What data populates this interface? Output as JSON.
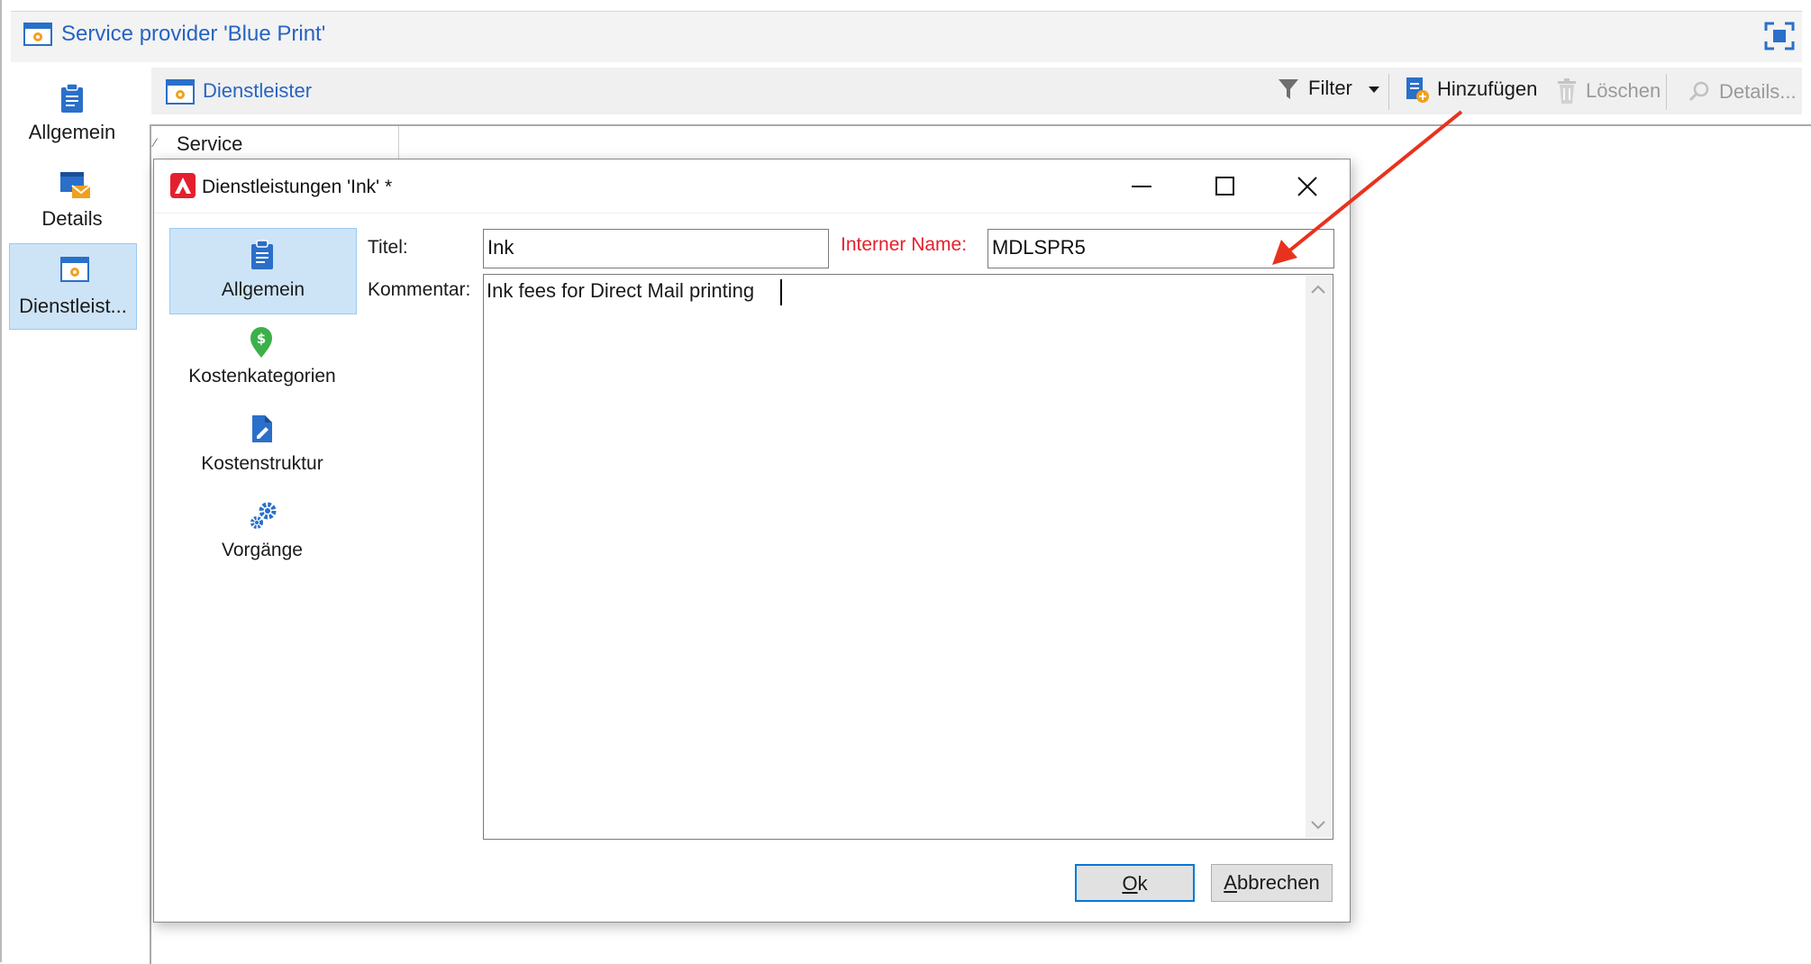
{
  "window": {
    "title": "Service provider 'Blue Print'",
    "title_icon": "provider-window-icon",
    "maximize_icon": "fullscreen-icon"
  },
  "left_nav": [
    {
      "label": "Allgemein",
      "icon": "clipboard-icon"
    },
    {
      "label": "Details",
      "icon": "details-mail-icon"
    },
    {
      "label": "Dienstleist...",
      "icon": "service-window-icon",
      "selected": true
    }
  ],
  "toolbar": {
    "section_label": "Dienstleister",
    "filter_label": "Filter",
    "add_label": "Hinzufügen",
    "delete_label": "Löschen",
    "details_label": "Details..."
  },
  "list": {
    "column_header": "Service"
  },
  "dialog": {
    "title": "Dienstleistungen 'Ink' *",
    "nav": [
      {
        "label": "Allgemein",
        "icon": "clipboard-icon",
        "selected": true
      },
      {
        "label": "Kostenkategorien",
        "icon": "dollar-pin-icon"
      },
      {
        "label": "Kostenstruktur",
        "icon": "edit-document-icon"
      },
      {
        "label": "Vorgänge",
        "icon": "gears-icon"
      }
    ],
    "fields": {
      "title_label": "Titel:",
      "title_value": "Ink",
      "internal_name_label": "Interner Name:",
      "internal_name_value": "MDLSPR5",
      "comment_label": "Kommentar:",
      "comment_value": "Ink fees for Direct Mail printing"
    },
    "buttons": {
      "ok_mnemonic": "O",
      "ok_rest": "k",
      "cancel_mnemonic": "A",
      "cancel_rest": "bbrechen"
    }
  },
  "colors": {
    "accent": "#2764c3",
    "selection": "#cde4f7",
    "required_label": "#e5202e",
    "annotation_arrow": "#e8321e"
  }
}
